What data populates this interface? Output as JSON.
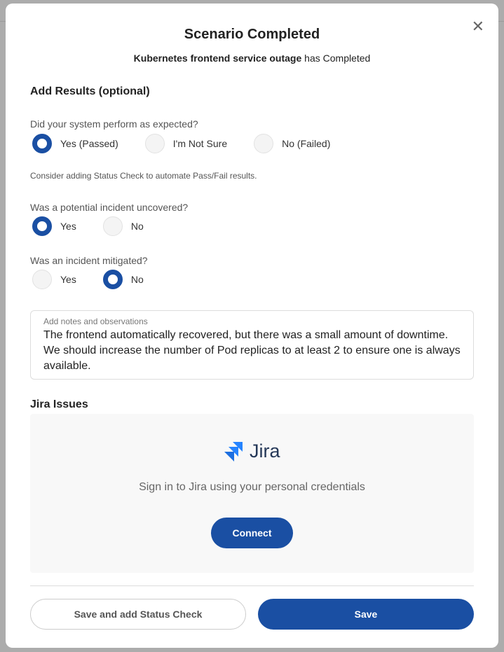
{
  "modal": {
    "title": "Scenario Completed",
    "subtitle_bold": "Kubernetes frontend service outage",
    "subtitle_rest": " has Completed",
    "close_icon": "close-icon"
  },
  "results": {
    "heading": "Add Results (optional)",
    "q1": {
      "label": "Did your system perform as expected?",
      "options": [
        "Yes (Passed)",
        "I'm Not Sure",
        "No (Failed)"
      ],
      "selected": "Yes (Passed)"
    },
    "hint": "Consider adding Status Check to automate Pass/Fail results.",
    "q2": {
      "label": "Was a potential incident uncovered?",
      "options": [
        "Yes",
        "No"
      ],
      "selected": "Yes"
    },
    "q3": {
      "label": "Was an incident mitigated?",
      "options": [
        "Yes",
        "No"
      ],
      "selected": "No"
    },
    "notes": {
      "placeholder": "Add notes and observations",
      "value": "The frontend automatically recovered, but there was a small amount of downtime. We should increase the number of Pod replicas to at least 2 to ensure one is always available."
    }
  },
  "jira": {
    "heading": "Jira Issues",
    "logo_text": "Jira",
    "text": "Sign in to Jira using your personal credentials",
    "connect": "Connect"
  },
  "footer": {
    "secondary": "Save and add Status Check",
    "primary": "Save"
  },
  "colors": {
    "accent": "#1a4fa3",
    "jira_blue": "#2684ff"
  }
}
